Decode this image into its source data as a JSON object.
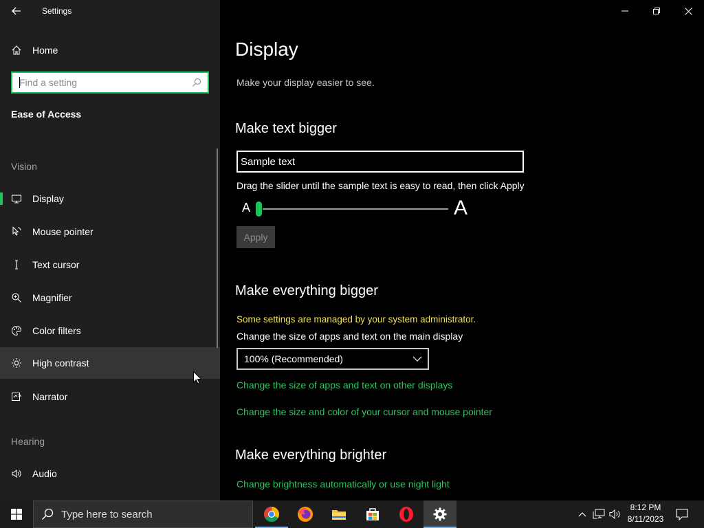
{
  "window": {
    "app_title": "Settings",
    "controls": [
      "minimize",
      "restore",
      "close"
    ]
  },
  "sidebar": {
    "home_label": "Home",
    "search_placeholder": "Find a setting",
    "section_title": "Ease of Access",
    "groups": {
      "vision": "Vision",
      "hearing": "Hearing"
    },
    "items": [
      {
        "label": "Display",
        "icon": "monitor-icon",
        "selected": true
      },
      {
        "label": "Mouse pointer",
        "icon": "mouse-pointer-icon"
      },
      {
        "label": "Text cursor",
        "icon": "text-cursor-icon"
      },
      {
        "label": "Magnifier",
        "icon": "magnifier-icon"
      },
      {
        "label": "Color filters",
        "icon": "color-filters-icon"
      },
      {
        "label": "High contrast",
        "icon": "high-contrast-icon",
        "hovered": true
      },
      {
        "label": "Narrator",
        "icon": "narrator-icon"
      },
      {
        "label": "Audio",
        "icon": "speaker-icon"
      }
    ]
  },
  "main": {
    "title": "Display",
    "subtitle": "Make your display easier to see.",
    "text_bigger": {
      "heading": "Make text bigger",
      "sample_text": "Sample text",
      "hint": "Drag the slider until the sample text is easy to read, then click Apply",
      "small_a": "A",
      "big_a": "A",
      "slider_value_percent": 100,
      "apply_label": "Apply"
    },
    "everything_bigger": {
      "heading": "Make everything bigger",
      "admin_note": "Some settings are managed by your system administrator.",
      "size_label": "Change the size of apps and text on the main display",
      "size_value": "100% (Recommended)",
      "link_other_displays": "Change the size of apps and text on other displays",
      "link_cursor": "Change the size and color of your cursor and mouse pointer"
    },
    "everything_brighter": {
      "heading": "Make everything brighter",
      "link_brightness": "Change brightness automatically or use night light"
    }
  },
  "taskbar": {
    "search_placeholder": "Type here to search",
    "apps": [
      "chrome-icon",
      "firefox-icon",
      "file-explorer-icon",
      "store-icon",
      "opera-icon",
      "settings-icon"
    ],
    "time": "8:12 PM",
    "date": "8/11/2023"
  },
  "colors": {
    "accent": "#1ec45a",
    "link": "#2fc25f",
    "warning": "#f0e05a",
    "sidebar_bg": "#1f1f1f",
    "main_bg": "#000000"
  }
}
